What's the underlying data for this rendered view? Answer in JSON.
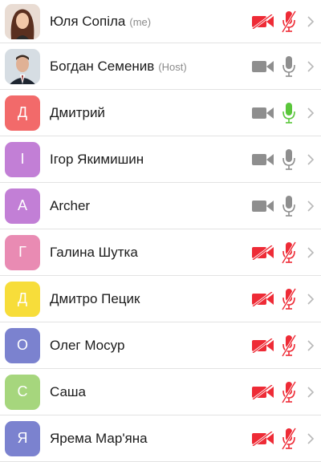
{
  "participants": [
    {
      "name": "Юля Сопіла",
      "suffix": "(me)",
      "avatar_type": "photo",
      "photo": "woman",
      "video_on": false,
      "audio": "muted"
    },
    {
      "name": "Богдан Семенив",
      "suffix": "(Host)",
      "avatar_type": "photo",
      "photo": "man",
      "video_on": true,
      "audio": "on"
    },
    {
      "name": "Дмитрий",
      "suffix": "",
      "avatar_type": "initial",
      "initial": "Д",
      "avatar_color": "#f26a6a",
      "video_on": true,
      "audio": "speaking"
    },
    {
      "name": "Ігор Якимишин",
      "suffix": "",
      "avatar_type": "initial",
      "initial": "І",
      "avatar_color": "#c27fd6",
      "video_on": true,
      "audio": "on"
    },
    {
      "name": "Archer",
      "suffix": "",
      "avatar_type": "initial",
      "initial": "A",
      "avatar_color": "#c27fd6",
      "video_on": true,
      "audio": "on"
    },
    {
      "name": "Галина Шутка",
      "suffix": "",
      "avatar_type": "initial",
      "initial": "Г",
      "avatar_color": "#e98bb3",
      "video_on": false,
      "audio": "muted"
    },
    {
      "name": "Дмитро Пецик",
      "suffix": "",
      "avatar_type": "initial",
      "initial": "Д",
      "avatar_color": "#f7dd3a",
      "video_on": false,
      "audio": "muted"
    },
    {
      "name": "Олег Мосур",
      "suffix": "",
      "avatar_type": "initial",
      "initial": "О",
      "avatar_color": "#7b82cf",
      "video_on": false,
      "audio": "muted"
    },
    {
      "name": "Саша",
      "suffix": "",
      "avatar_type": "initial",
      "initial": "С",
      "avatar_color": "#a6d67d",
      "video_on": false,
      "audio": "muted"
    },
    {
      "name": "Ярема Мар'яна",
      "suffix": "",
      "avatar_type": "initial",
      "initial": "Я",
      "avatar_color": "#7b82cf",
      "video_on": false,
      "audio": "muted"
    }
  ],
  "colors": {
    "muted": "#ee2b36",
    "icon_gray": "#8e8e8e",
    "speaking": "#5ac63b",
    "chevron": "#b8b8b8"
  }
}
